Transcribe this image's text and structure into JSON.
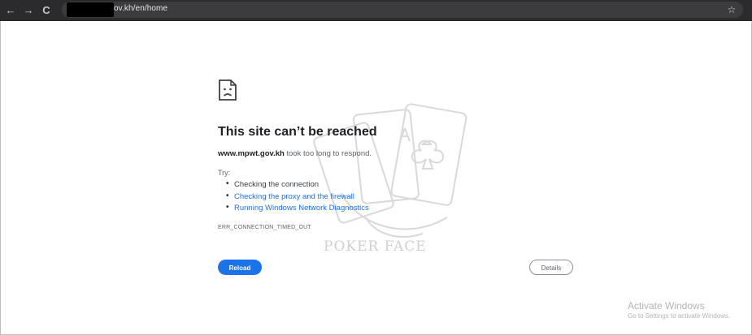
{
  "browser": {
    "url_text": "ov.kh/en/home",
    "back_glyph": "←",
    "forward_glyph": "→",
    "reload_glyph": "C",
    "star_glyph": "☆"
  },
  "error": {
    "title": "This site can’t be reached",
    "host": "www.mpwt.gov.kh",
    "host_suffix": " took too long to respond.",
    "try_label": "Try:",
    "suggestions": [
      "Checking the connection",
      "Checking the proxy and the firewall",
      "Running Windows Network Diagnostics"
    ],
    "code": "ERR_CONNECTION_TIMED_OUT",
    "reload_label": "Reload",
    "details_label": "Details"
  },
  "watermark": {
    "text": "POKER FACE"
  },
  "activation": {
    "title": "Activate Windows",
    "subtitle": "Go to Settings to activate Windows."
  },
  "colors": {
    "accent": "#1a73e8",
    "chrome_bg": "#2b2b2d",
    "link": "#1a73e8"
  },
  "icons": [
    "back-icon",
    "forward-icon",
    "reload-icon",
    "star-icon",
    "sad-page-icon"
  ]
}
